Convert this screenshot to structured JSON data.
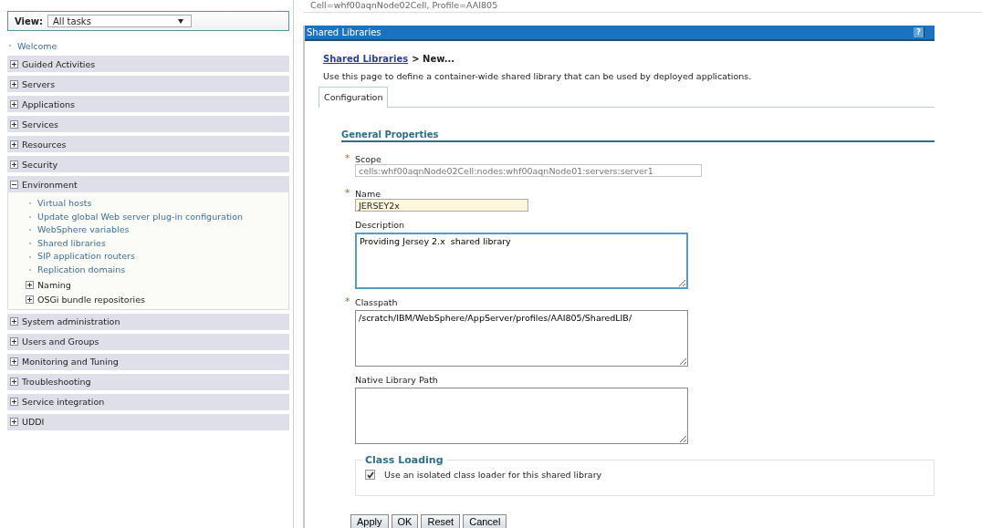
{
  "view_selector": {
    "label": "View:",
    "value": "All tasks"
  },
  "nav": [
    {
      "kind": "link",
      "label": "Welcome"
    },
    {
      "kind": "group",
      "label": "Guided Activities",
      "expanded": false
    },
    {
      "kind": "group",
      "label": "Servers",
      "expanded": false
    },
    {
      "kind": "group",
      "label": "Applications",
      "expanded": false
    },
    {
      "kind": "group",
      "label": "Services",
      "expanded": false
    },
    {
      "kind": "group",
      "label": "Resources",
      "expanded": false
    },
    {
      "kind": "group",
      "label": "Security",
      "expanded": false
    },
    {
      "kind": "group",
      "label": "Environment",
      "expanded": true,
      "children": [
        {
          "kind": "link",
          "label": "Virtual hosts"
        },
        {
          "kind": "link",
          "label": "Update global Web server plug-in configuration"
        },
        {
          "kind": "link",
          "label": "WebSphere variables"
        },
        {
          "kind": "link",
          "label": "Shared libraries"
        },
        {
          "kind": "link",
          "label": "SIP application routers"
        },
        {
          "kind": "link",
          "label": "Replication domains"
        },
        {
          "kind": "group",
          "label": "Naming",
          "expanded": false
        },
        {
          "kind": "group",
          "label": "OSGi bundle repositories",
          "expanded": false
        }
      ]
    },
    {
      "kind": "group",
      "label": "System administration",
      "expanded": false
    },
    {
      "kind": "group",
      "label": "Users and Groups",
      "expanded": false
    },
    {
      "kind": "group",
      "label": "Monitoring and Tuning",
      "expanded": false
    },
    {
      "kind": "group",
      "label": "Troubleshooting",
      "expanded": false
    },
    {
      "kind": "group",
      "label": "Service integration",
      "expanded": false
    },
    {
      "kind": "group",
      "label": "UDDI",
      "expanded": false
    }
  ],
  "context_line": "Cell=whf00aqnNode02Cell, Profile=AAI805",
  "panel": {
    "title": "Shared Libraries",
    "help": "?",
    "breadcrumb": {
      "link": "Shared Libraries",
      "current": "> New..."
    },
    "intro": "Use this page to define a container-wide shared library that can be used by deployed applications.",
    "tabs": [
      {
        "label": "Configuration",
        "selected": true
      }
    ],
    "section": "General Properties",
    "fields": [
      {
        "kind": "text",
        "label": "Scope",
        "required_mark": "*",
        "readonly": true,
        "highlighted": false,
        "focused": false,
        "value": "cells:whf00aqnNode02Cell:nodes:whf00aqnNode01:servers:server1"
      },
      {
        "kind": "text",
        "label": "Name",
        "required_mark": "*",
        "readonly": false,
        "highlighted": true,
        "focused": false,
        "value": "JERSEY2x"
      },
      {
        "kind": "textarea",
        "label": "Description",
        "readonly": false,
        "highlighted": false,
        "focused": true,
        "value": "Providing Jersey 2.x  shared library "
      },
      {
        "kind": "textarea",
        "label": "Classpath",
        "required_mark": "*",
        "readonly": false,
        "highlighted": false,
        "focused": false,
        "value": "/scratch/IBM/WebSphere/AppServer/profiles/AAI805/SharedLIB/"
      },
      {
        "kind": "textarea",
        "label": "Native Library Path",
        "readonly": false,
        "highlighted": false,
        "focused": false
      }
    ],
    "class_loading": {
      "title": "Class Loading",
      "checkbox": {
        "label": "Use an isolated class loader for this shared library",
        "checked": true
      }
    },
    "buttons": [
      "Apply",
      "OK",
      "Reset",
      "Cancel"
    ]
  }
}
